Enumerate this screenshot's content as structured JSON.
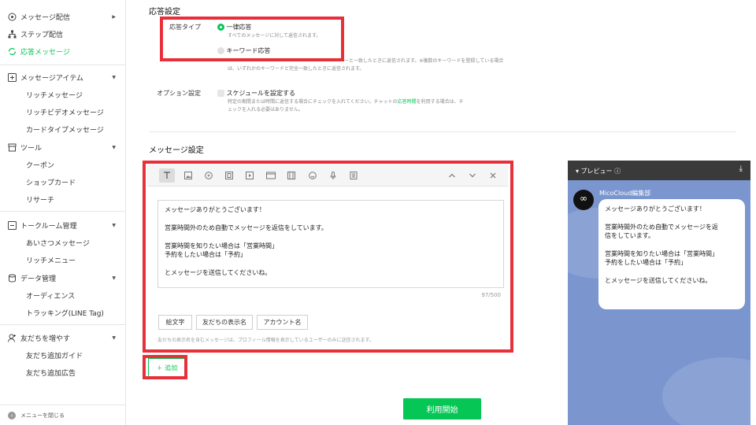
{
  "sidebar": {
    "items": [
      {
        "label": "メッセージ配信",
        "arrow": "▶"
      },
      {
        "label": "ステップ配信"
      },
      {
        "label": "応答メッセージ"
      },
      {
        "label": "メッセージアイテム",
        "arrow": "▼"
      },
      {
        "label": "リッチメッセージ"
      },
      {
        "label": "リッチビデオメッセージ"
      },
      {
        "label": "カードタイプメッセージ"
      },
      {
        "label": "ツール",
        "arrow": "▼"
      },
      {
        "label": "クーポン"
      },
      {
        "label": "ショップカード"
      },
      {
        "label": "リサーチ"
      },
      {
        "label": "トークルーム管理",
        "arrow": "▼"
      },
      {
        "label": "あいさつメッセージ"
      },
      {
        "label": "リッチメニュー"
      },
      {
        "label": "データ管理",
        "arrow": "▼"
      },
      {
        "label": "オーディエンス"
      },
      {
        "label": "トラッキング(LINE Tag)"
      },
      {
        "label": "友だちを増やす",
        "arrow": "▼"
      },
      {
        "label": "友だち追加ガイド"
      },
      {
        "label": "友だち追加広告"
      }
    ],
    "close_menu": "メニューを閉じる"
  },
  "response": {
    "section_title": "応答設定",
    "type_label": "応答タイプ",
    "option_all": "一律応答",
    "option_all_desc": "すべてのメッセージに対して返信されます。",
    "option_keyword": "キーワード応答",
    "option_keyword_desc1": "ーと一致したときに返信されます。※複数のキーワードを登録している場合",
    "option_keyword_desc2": "は、いずれかのキーワードと完全一致したときに返信されます。",
    "option_label": "オプション設定",
    "schedule_label": "スケジュールを設定する",
    "schedule_desc1_pre": "特定の期間または時間に返信する場合にチェックを入れてください。チャットの",
    "schedule_desc1_link": "応答時間",
    "schedule_desc1_post": "を利用する場合は、チ",
    "schedule_desc2": "ェックを入れる必要はありません。"
  },
  "message": {
    "section_title": "メッセージ設定",
    "body": "メッセージありがとうございます！\n\n営業時間外のため自動でメッセージを返信をしています。\n\n営業時間を知りたい場合は「営業時間」\n予約をしたい場合は「予約」\n\nとメッセージを送信してくださいね。",
    "counter": "97/500",
    "chips": [
      "絵文字",
      "友だちの表示名",
      "アカウント名"
    ],
    "note": "友だちの表示名を含むメッセージは、プロフィール情報を表示しているユーザーのみに送信されます。",
    "add_label": "＋ 追加",
    "start_label": "利用開始"
  },
  "preview": {
    "title": "▾ プレビュー ⓘ",
    "account": "MicoCloud編集部",
    "bubble": "メッセージありがとうございます！\n\n営業時間外のため自動でメッセージを返\n信をしています。\n\n営業時間を知りたい場合は「営業時間」\n予約をしたい場合は「予約」\n\nとメッセージを送信してくださいね。"
  },
  "colors": {
    "accent": "#06c755",
    "highlight": "#e8303a",
    "preview_bg": "#7b96cf"
  },
  "icons": {
    "toolbar": [
      "text-icon",
      "image-icon",
      "stamp-icon",
      "video-icon",
      "play-icon",
      "card-icon",
      "rich-video-icon",
      "emoji-icon",
      "mic-icon",
      "list-icon"
    ]
  }
}
